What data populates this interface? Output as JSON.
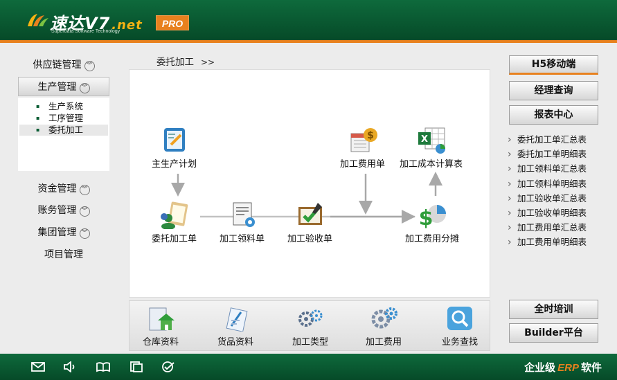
{
  "header": {
    "logo_main": "速达V7",
    "logo_net": ".net",
    "logo_sub": "Superdata Software Technology",
    "badge": "PRO"
  },
  "nav": {
    "groups": [
      {
        "label": "供应链管理",
        "has_chevron": true
      },
      {
        "label": "生产管理",
        "has_chevron": true,
        "active": true
      },
      {
        "label": "资金管理",
        "has_chevron": true
      },
      {
        "label": "账务管理",
        "has_chevron": true
      },
      {
        "label": "集团管理",
        "has_chevron": true
      },
      {
        "label": "项目管理",
        "has_chevron": false
      }
    ],
    "sub_items": [
      "生产系统",
      "工序管理",
      "委托加工"
    ],
    "selected_sub": "委托加工",
    "chevron_glyph": "︾"
  },
  "breadcrumb": {
    "current": "委托加工",
    "arrow": ">>"
  },
  "flow": {
    "nodes": [
      {
        "label": "主生产计划",
        "icon": "production-plan-icon"
      },
      {
        "label": "委托加工单",
        "icon": "outsource-order-icon"
      },
      {
        "label": "加工领料单",
        "icon": "material-requisition-icon"
      },
      {
        "label": "加工验收单",
        "icon": "acceptance-icon"
      },
      {
        "label": "加工费用单",
        "icon": "cost-document-icon"
      },
      {
        "label": "加工成本计算表",
        "icon": "cost-spreadsheet-icon"
      },
      {
        "label": "加工费用分摊",
        "icon": "cost-allocation-icon"
      }
    ]
  },
  "toolbar": {
    "items": [
      {
        "label": "仓库资料",
        "icon": "warehouse-icon"
      },
      {
        "label": "货品资料",
        "icon": "goods-icon"
      },
      {
        "label": "加工类型",
        "icon": "process-type-icon"
      },
      {
        "label": "加工费用",
        "icon": "gears-icon"
      },
      {
        "label": "业务查找",
        "icon": "search-icon"
      }
    ]
  },
  "right": {
    "buttons": [
      "H5移动端",
      "经理查询",
      "报表中心"
    ],
    "reports": [
      "委托加工单汇总表",
      "委托加工单明细表",
      "加工领料单汇总表",
      "加工领料单明细表",
      "加工验收单汇总表",
      "加工验收单明细表",
      "加工费用单汇总表",
      "加工费用单明细表"
    ],
    "bottom_buttons": [
      "全时培训",
      "Builder平台"
    ]
  },
  "footer": {
    "icons": [
      "mail-icon",
      "speaker-icon",
      "book-icon",
      "document-icon",
      "check-icon"
    ],
    "brand_prefix": "企业级",
    "brand_erp": "ERP",
    "brand_suffix": "软件"
  },
  "colors": {
    "green": "#0a5d34",
    "orange": "#e8811e",
    "panel": "#ffffff",
    "bg": "#ececec"
  }
}
